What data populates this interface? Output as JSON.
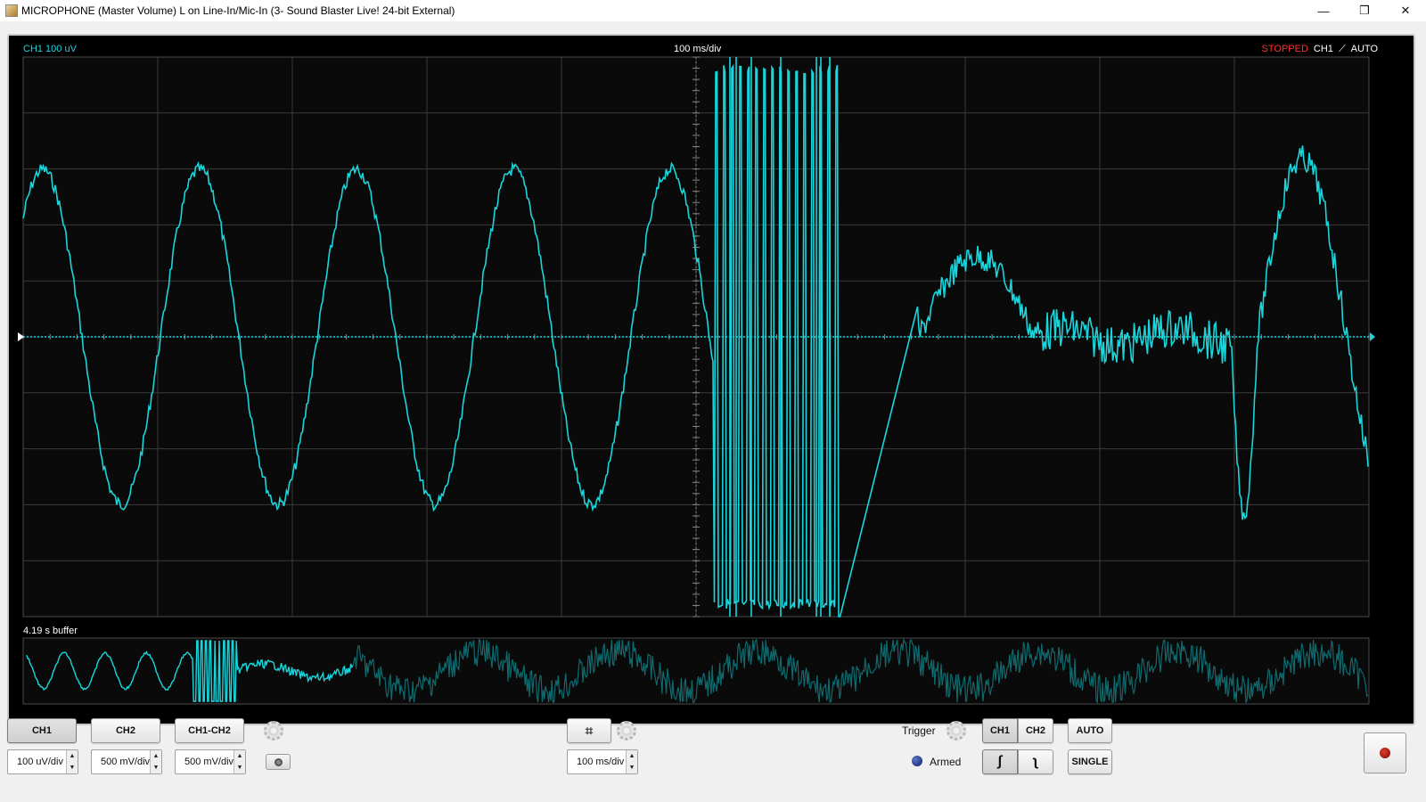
{
  "window": {
    "title": "MICROPHONE (Master Volume) L on Line-In/Mic-In (3- Sound Blaster Live! 24-bit External)",
    "minimize": "—",
    "restore": "❐",
    "close": "✕"
  },
  "scope": {
    "ch1_label": "CH1 100 uV",
    "timebase_label": "100 ms/div",
    "status": "STOPPED",
    "trigger_channel": "CH1",
    "trigger_slope_icon": "rising-edge-icon",
    "trigger_mode": "AUTO",
    "buffer_label": "4.19 s buffer",
    "colors": {
      "trace": "#19d6dc",
      "grid": "#3a3a3a",
      "stopped": "#ff3030",
      "ch1_label": "#19d6dc",
      "overview_dim": "#0e6a6e"
    }
  },
  "controls": {
    "channel_buttons": [
      "CH1",
      "CH2",
      "CH1-CH2"
    ],
    "active_channel": "CH1",
    "ch1_scale": "100 uV/div",
    "ch2_scale": "500 mV/div",
    "diff_scale": "500 mV/div",
    "timebase": "100 ms/div",
    "trigger_label": "Trigger",
    "trigger_ch1": "CH1",
    "trigger_ch2": "CH2",
    "auto_button": "AUTO",
    "single_button": "SINGLE",
    "armed_label": "Armed"
  }
}
